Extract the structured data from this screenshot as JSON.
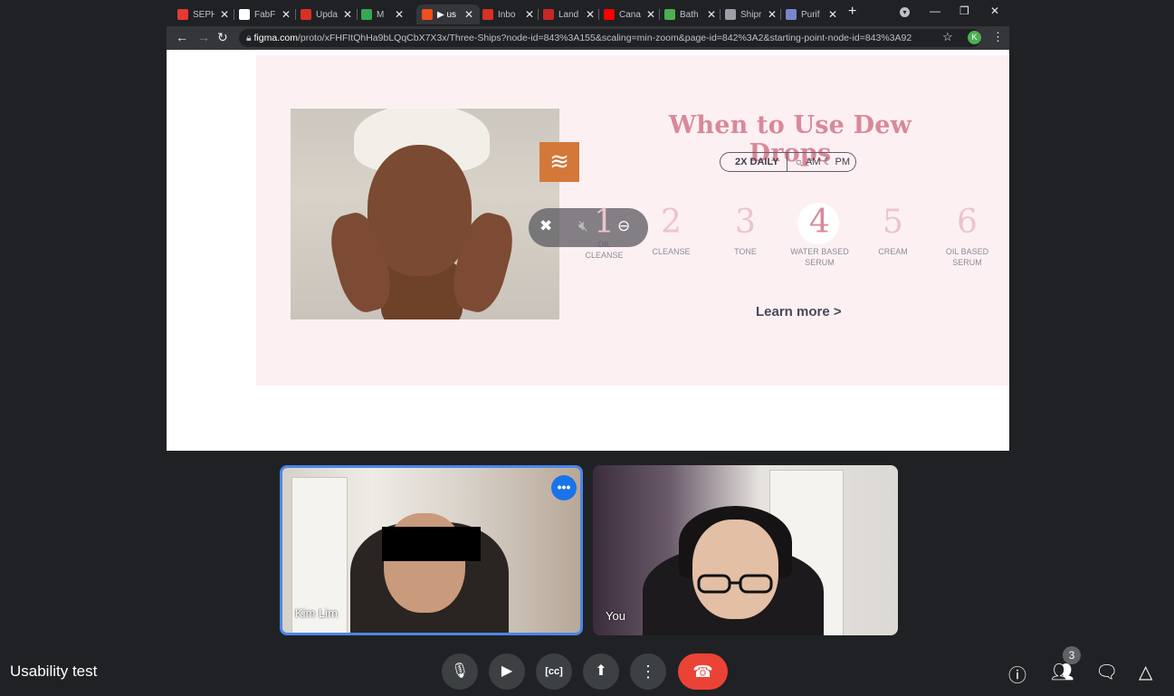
{
  "browser": {
    "tabs": [
      {
        "title": "SEPH",
        "favicon_color": "#e53935"
      },
      {
        "title": "FabFi",
        "favicon_color": "#ffffff"
      },
      {
        "title": "Upda",
        "favicon_color": "#d93025"
      },
      {
        "title": "M",
        "favicon_color": "#34a853"
      },
      {
        "title": "▶ us",
        "favicon_color": "#f24e1e"
      },
      {
        "title": "Inbo",
        "favicon_color": "#d93025"
      },
      {
        "title": "Land",
        "favicon_color": "#c62828"
      },
      {
        "title": "Cana",
        "favicon_color": "#ff0000"
      },
      {
        "title": "Bath",
        "favicon_color": "#4caf50"
      },
      {
        "title": "Shipr",
        "favicon_color": "#9aa0a6"
      },
      {
        "title": "Purif",
        "favicon_color": "#7986cb"
      }
    ],
    "active_tab_index": 4,
    "url_domain": "figma.com",
    "url_path": "/proto/xFHFItQhHa9bLQqCbX7X3x/Three-Ships?node-id=843%3A155&scaling=min-zoom&page-id=842%3A2&starting-point-node-id=843%3A92",
    "profile_initial": "K"
  },
  "slide": {
    "heading": "When to Use Dew Drops",
    "frequency": "2X DAILY",
    "times": "☼ AM ☾ PM",
    "steps": [
      {
        "num": "1",
        "label": "OIL CLEANSE"
      },
      {
        "num": "2",
        "label": "CLEANSE"
      },
      {
        "num": "3",
        "label": "TONE"
      },
      {
        "num": "4",
        "label": "WATER BASED SERUM"
      },
      {
        "num": "5",
        "label": "CREAM"
      },
      {
        "num": "6",
        "label": "OIL BASED SERUM"
      }
    ],
    "highlighted_step": "4",
    "learn_more": "Learn more >"
  },
  "participants": [
    {
      "name": "Kim Lim"
    },
    {
      "name": "You"
    }
  ],
  "meeting": {
    "title": "Usability test",
    "participant_count": "3"
  }
}
